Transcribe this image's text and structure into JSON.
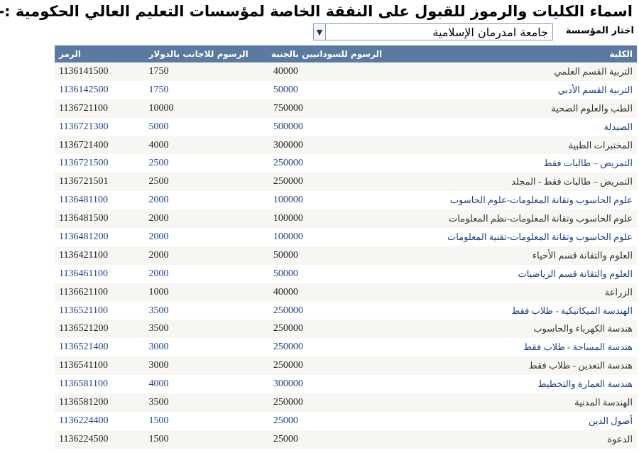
{
  "title": "اسماء الكليات والرموز للقبول على النفقة الخاصة لمؤسسات التعليم العالي الحكومية :-",
  "selector": {
    "label": "اختار المؤسسة",
    "value": "جامعة امدرمان الإسلامية"
  },
  "table": {
    "headers": {
      "college": "الكلية",
      "fee_sd": "الرسوم للسودانيين بالجنية",
      "fee_usd": "الرسوم للاجانب بالدولار",
      "code": "الرمز"
    },
    "rows": [
      {
        "college": "التربية القسم العلمي",
        "fee_sd": "40000",
        "fee_usd": "1750",
        "code": "1136141500"
      },
      {
        "college": "التربية القسم الأدبي",
        "fee_sd": "50000",
        "fee_usd": "1750",
        "code": "1136142500"
      },
      {
        "college": "الطب والعلوم الصحية",
        "fee_sd": "750000",
        "fee_usd": "10000",
        "code": "1136721100"
      },
      {
        "college": "الصيدلة",
        "fee_sd": "500000",
        "fee_usd": "5000",
        "code": "1136721300"
      },
      {
        "college": "المختبرات الطبية",
        "fee_sd": "300000",
        "fee_usd": "4000",
        "code": "1136721400"
      },
      {
        "college": "التمريض – طالبات فقط",
        "fee_sd": "250000",
        "fee_usd": "2500",
        "code": "1136721500"
      },
      {
        "college": "التمريض – طالبات فقط - المجلد",
        "fee_sd": "250000",
        "fee_usd": "2500",
        "code": "1136721501"
      },
      {
        "college": "علوم الحاسوب وتقانة المعلومات-علوم الحاسوب",
        "fee_sd": "100000",
        "fee_usd": "2000",
        "code": "1136481100"
      },
      {
        "college": "علوم الحاسوب وتقانة المعلومات-نظم المعلومات",
        "fee_sd": "100000",
        "fee_usd": "2000",
        "code": "1136481500"
      },
      {
        "college": "علوم الحاسوب وتقانة المعلومات-تقنية المعلومات",
        "fee_sd": "100000",
        "fee_usd": "2000",
        "code": "1136481200"
      },
      {
        "college": "العلوم والتقانة قسم الأحياء",
        "fee_sd": "50000",
        "fee_usd": "2000",
        "code": "1136421100"
      },
      {
        "college": "العلوم والتقانة قسم الرياضيات",
        "fee_sd": "50000",
        "fee_usd": "2000",
        "code": "1136461100"
      },
      {
        "college": "الزراعة",
        "fee_sd": "40000",
        "fee_usd": "1000",
        "code": "1136621100"
      },
      {
        "college": "الهندسة الميكانيكية - طلاب فقط",
        "fee_sd": "250000",
        "fee_usd": "3500",
        "code": "1136521100"
      },
      {
        "college": "هندسة الكهرباء والحاسوب",
        "fee_sd": "250000",
        "fee_usd": "3500",
        "code": "1136521200"
      },
      {
        "college": "هندسة المساحة - طلاب فقط",
        "fee_sd": "250000",
        "fee_usd": "3000",
        "code": "1136521400"
      },
      {
        "college": "هندسة التعدين - طلاب فقط",
        "fee_sd": "250000",
        "fee_usd": "3000",
        "code": "1136541100"
      },
      {
        "college": "هندسة العمارة والتخطيط",
        "fee_sd": "300000",
        "fee_usd": "4000",
        "code": "1136581100"
      },
      {
        "college": "الهندسة المدنية",
        "fee_sd": "250000",
        "fee_usd": "3500",
        "code": "1136581200"
      },
      {
        "college": "أصول الدين",
        "fee_sd": "25000",
        "fee_usd": "1500",
        "code": "1136224400"
      },
      {
        "college": "الدعوة",
        "fee_sd": "25000",
        "fee_usd": "1500",
        "code": "1136224500"
      }
    ]
  },
  "colors": {
    "header_bg": "#5b7aa1",
    "link_text": "#1f3f85",
    "row_alt": "#f7f6f3"
  }
}
